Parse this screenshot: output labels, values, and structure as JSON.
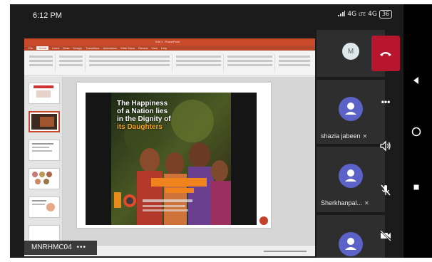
{
  "status": {
    "time": "6:12 PM",
    "network": "4G",
    "network_sub": "LTE",
    "network2": "4G",
    "battery": "36"
  },
  "ppt": {
    "title": "Edit 1 - PowerPoint",
    "tabs": [
      "File",
      "Home",
      "Insert",
      "Draw",
      "Design",
      "Transitions",
      "Animations",
      "Slide Show",
      "Review",
      "View",
      "Help"
    ],
    "active_tab": "Home",
    "slide": {
      "title_lines": [
        "The Happiness",
        "of a Nation lies",
        "in the Dignity of"
      ],
      "title_highlight": "its Daughters"
    }
  },
  "presenter": {
    "name": "MNRHMC04",
    "menu": "•••"
  },
  "participants": [
    {
      "initial": "M",
      "name": ""
    },
    {
      "initial": "",
      "name": "shazia jabeen"
    },
    {
      "initial": "",
      "name": "Sherkhanpal..."
    },
    {
      "initial": "",
      "name": ""
    }
  ],
  "controls": {
    "more": "•••"
  },
  "colors": {
    "accent_red": "#b8162f",
    "ppt_orange": "#c94a2b",
    "avatar_blue": "#5b63c9",
    "avatar_light": "#dde6ea"
  },
  "icons": {
    "end_call": "phone-hangup-icon",
    "speaker": "speaker-icon",
    "mic_off": "mic-off-icon",
    "video_off": "video-off-icon"
  }
}
